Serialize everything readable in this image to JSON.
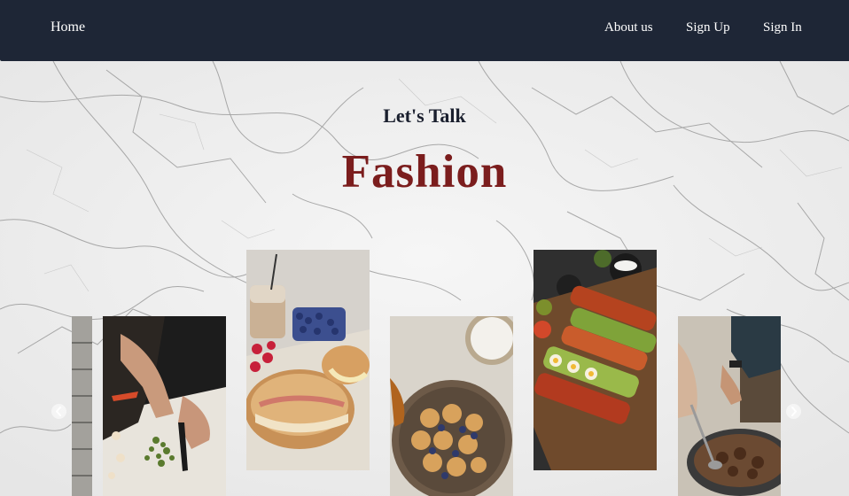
{
  "nav": {
    "home_label": "Home",
    "about_label": "About us",
    "signup_label": "Sign Up",
    "signin_label": "Sign In",
    "background": "#1e2636"
  },
  "hero": {
    "kicker": "Let's Talk",
    "headline": "Fashion",
    "headline_color": "#7b1d1d"
  },
  "carousel": {
    "cards": [
      {
        "subject": "partial-image"
      },
      {
        "subject": "chopping-herbs"
      },
      {
        "subject": "croissant-sandwich"
      },
      {
        "subject": "mini-pancakes"
      },
      {
        "subject": "loaded-toasts"
      },
      {
        "subject": "cooking-in-pan"
      }
    ],
    "prev_icon": "chevron-left-icon",
    "next_icon": "chevron-right-icon"
  }
}
